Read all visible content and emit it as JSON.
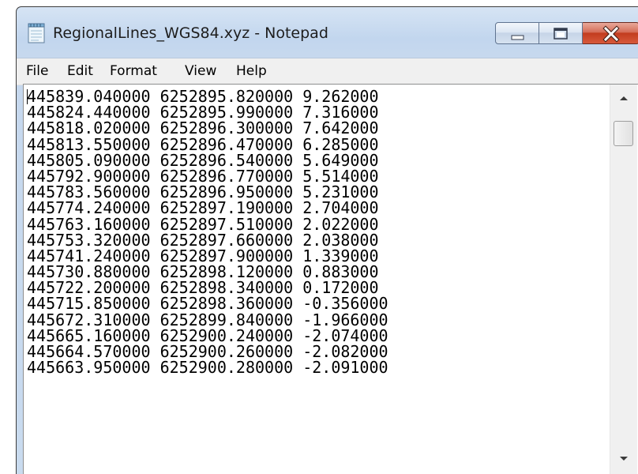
{
  "window": {
    "title": "RegionalLines_WGS84.xyz - Notepad",
    "app_icon": "notepad-icon"
  },
  "caption_buttons": {
    "minimize_icon": "minimize-icon",
    "maximize_icon": "maximize-icon",
    "close_icon": "close-icon"
  },
  "menu": {
    "items": [
      {
        "label": "File"
      },
      {
        "label": "Edit"
      },
      {
        "label": "Format"
      },
      {
        "label": "View"
      },
      {
        "label": "Help"
      }
    ]
  },
  "editor": {
    "lines": [
      "445839.040000 6252895.820000 9.262000",
      "445824.440000 6252895.990000 7.316000",
      "445818.020000 6252896.300000 7.642000",
      "445813.550000 6252896.470000 6.285000",
      "445805.090000 6252896.540000 5.649000",
      "445792.900000 6252896.770000 5.514000",
      "445783.560000 6252896.950000 5.231000",
      "445774.240000 6252897.190000 2.704000",
      "445763.160000 6252897.510000 2.022000",
      "445753.320000 6252897.660000 2.038000",
      "445741.240000 6252897.900000 1.339000",
      "445730.880000 6252898.120000 0.883000",
      "445722.200000 6252898.340000 0.172000",
      "445715.850000 6252898.360000 -0.356000",
      "445672.310000 6252899.840000 -1.966000",
      "445665.160000 6252900.240000 -2.074000",
      "445664.570000 6252900.260000 -2.082000",
      "445663.950000 6252900.280000 -2.091000"
    ]
  },
  "scrollbar": {
    "up_icon": "scroll-up-arrow-icon",
    "down_icon": "scroll-down-arrow-icon"
  },
  "colors": {
    "titlebar": "#c2d6ee",
    "close_button": "#c23c1f",
    "menubar": "#f0f0f0",
    "editor_bg": "#ffffff"
  }
}
